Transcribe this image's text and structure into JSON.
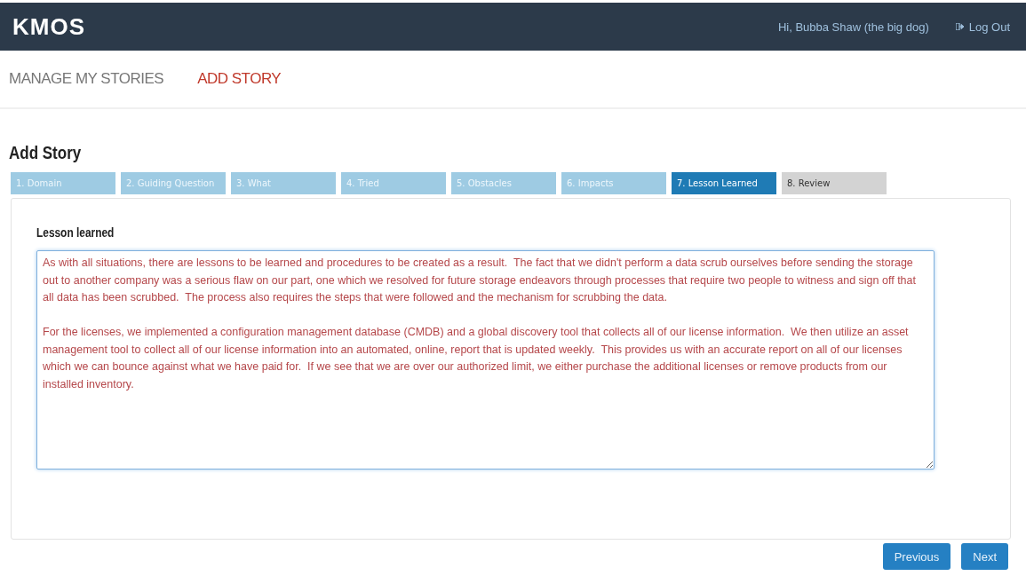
{
  "header": {
    "logo": "KMOS",
    "greeting": "Hi, Bubba Shaw (the big dog)",
    "logout": "Log Out"
  },
  "nav": [
    {
      "label": "MANAGE MY STORIES",
      "selected": false
    },
    {
      "label": "ADD STORY",
      "selected": true
    }
  ],
  "page_title": "Add Story",
  "steps": [
    {
      "label": "1. Domain",
      "selected": false,
      "completed": true
    },
    {
      "label": "2. Guiding Question",
      "selected": false,
      "completed": true
    },
    {
      "label": "3. What",
      "selected": false,
      "completed": true
    },
    {
      "label": "4. Tried",
      "selected": false,
      "completed": true
    },
    {
      "label": "5. Obstacles",
      "selected": false,
      "completed": true
    },
    {
      "label": "6. Impacts",
      "selected": false,
      "completed": true
    },
    {
      "label": "7. Lesson Learned",
      "selected": true,
      "completed": false
    },
    {
      "label": "8. Review",
      "selected": false,
      "completed": false
    }
  ],
  "field": {
    "label": "Lesson learned",
    "value": "As with all situations, there are lessons to be learned and procedures to be created as a result.  The fact that we didn't perform a data scrub ourselves before sending the storage out to another company was a serious flaw on our part, one which we resolved for future storage endeavors through processes that require two people to witness and sign off that all data has been scrubbed.  The process also requires the steps that were followed and the mechanism for scrubbing the data.\n\nFor the licenses, we implemented a configuration management database (CMDB) and a global discovery tool that collects all of our license information.  We then utilize an asset management tool to collect all of our license information into an automated, online, report that is updated weekly.  This provides us with an accurate report on all of our licenses which we can bounce against what we have paid for.  If we see that we are over our authorized limit, we either purchase the additional licenses or remove products from our installed inventory."
  },
  "buttons": [
    "Previous",
    "Next"
  ]
}
